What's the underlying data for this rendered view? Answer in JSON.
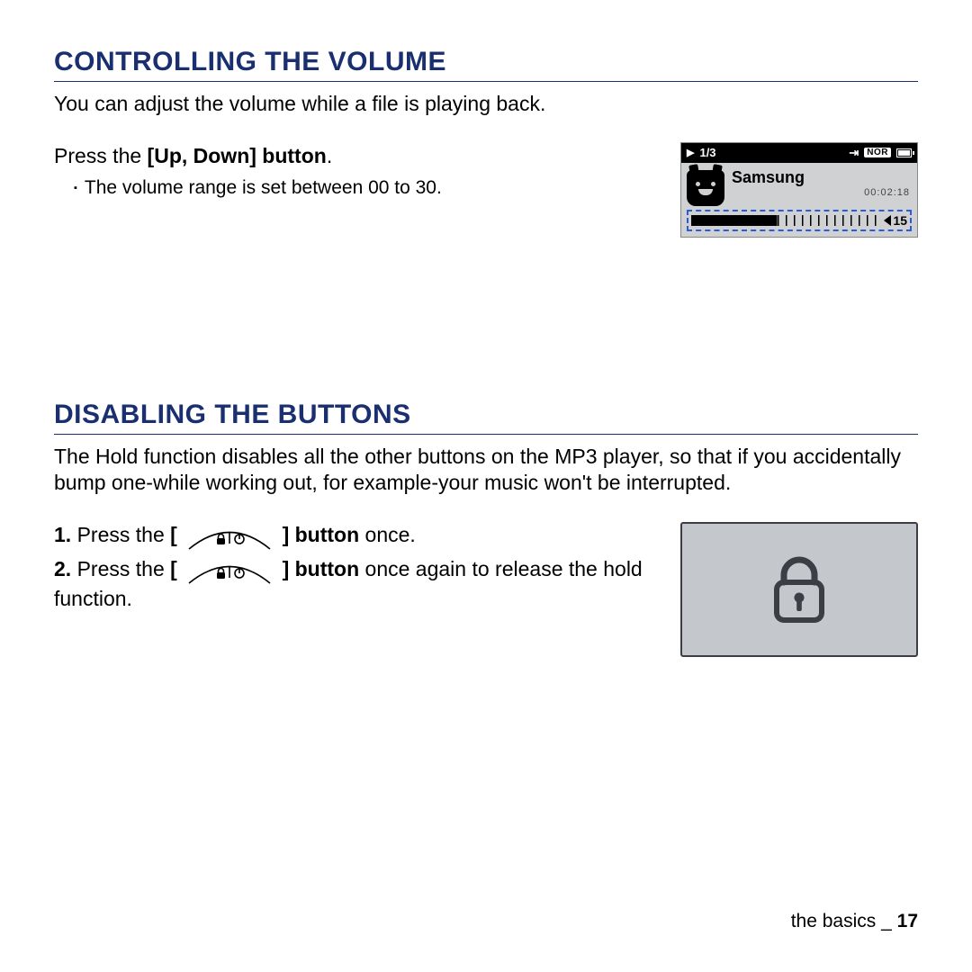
{
  "section1": {
    "title": "CONTROLLING THE VOLUME",
    "intro": "You can adjust the volume while a file is playing back.",
    "step_prefix": "Press the ",
    "step_bold": "[Up, Down] button",
    "step_suffix": ".",
    "bullet": "The volume range is set between 00 to 30."
  },
  "mini_screen": {
    "track_index": "1/3",
    "eq_badge": "NOR",
    "title": "Samsung",
    "time": "00:02:18",
    "volume_level": "15"
  },
  "section2": {
    "title": "DISABLING THE BUTTONS",
    "intro": "The Hold function disables all the other buttons on the MP3 player, so that if you accidentally bump one-while working out, for example-your music won't be interrupted.",
    "steps": [
      {
        "num": "1.",
        "pre": " Press the ",
        "bold_pre": "[ ",
        "bold_post": " ] button",
        "post": " once."
      },
      {
        "num": "2.",
        "pre": " Press the ",
        "bold_pre": "[ ",
        "bold_post": " ] button",
        "post": " once again to release the hold function."
      }
    ]
  },
  "footer": {
    "section": "the basics",
    "page": "17"
  }
}
